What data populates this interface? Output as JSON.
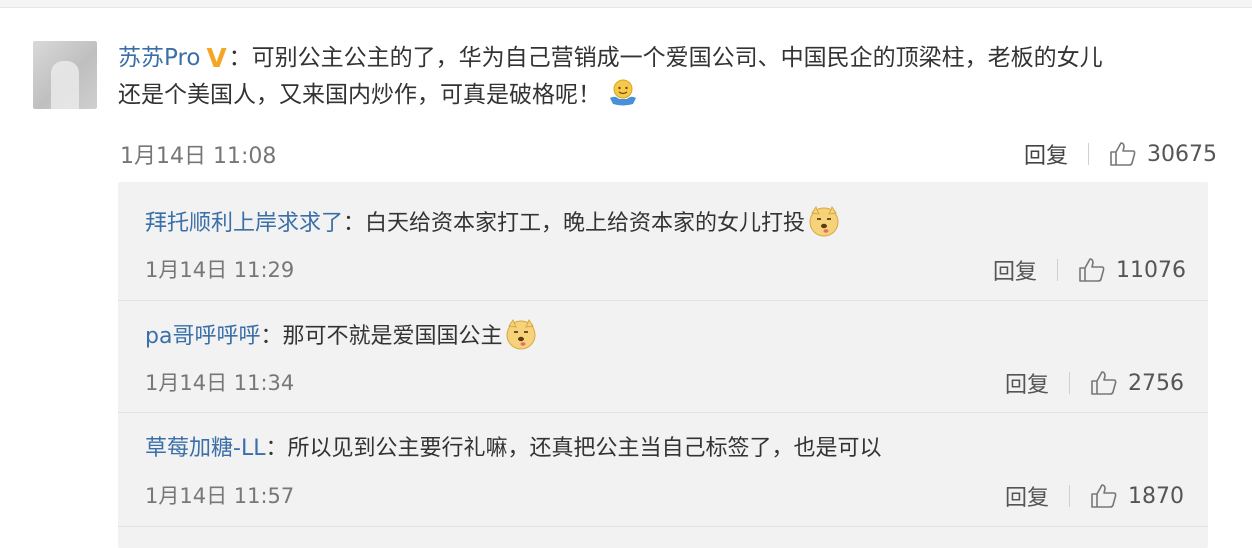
{
  "main_comment": {
    "username": "苏苏Pro",
    "verified_badge": "V",
    "colon": "：",
    "text_line1": "可别公主公主的了，华为自己营销成一个爱国公司、中国民企的顶梁柱，老板的女儿",
    "text_line2": "还是个美国人，又来国内炒作，可真是破格呢！",
    "emoji": "hug-emoji",
    "time": "1月14日 11:08",
    "reply_label": "回复",
    "likes": "30675"
  },
  "replies": [
    {
      "username": "拜托顺利上岸求求了",
      "colon": "：",
      "text": "白天给资本家打工，晚上给资本家的女儿打投",
      "emoji": "doge-emoji",
      "time": "1月14日 11:29",
      "reply_label": "回复",
      "likes": "11076"
    },
    {
      "username": "pa哥呼呼呼",
      "colon": "：",
      "text": "那可不就是爱国国公主",
      "emoji": "doge-emoji",
      "time": "1月14日 11:34",
      "reply_label": "回复",
      "likes": "2756"
    },
    {
      "username": "草莓加糖-LL",
      "colon": "：",
      "text": "所以见到公主要行礼嘛，还真把公主当自己标签了，也是可以",
      "emoji": "",
      "time": "1月14日 11:57",
      "reply_label": "回复",
      "likes": "1870"
    }
  ],
  "colors": {
    "username": "#3a6fa8",
    "badge": "#f5a623",
    "reply_bg": "#f2f2f2",
    "meta_text": "#777777"
  }
}
